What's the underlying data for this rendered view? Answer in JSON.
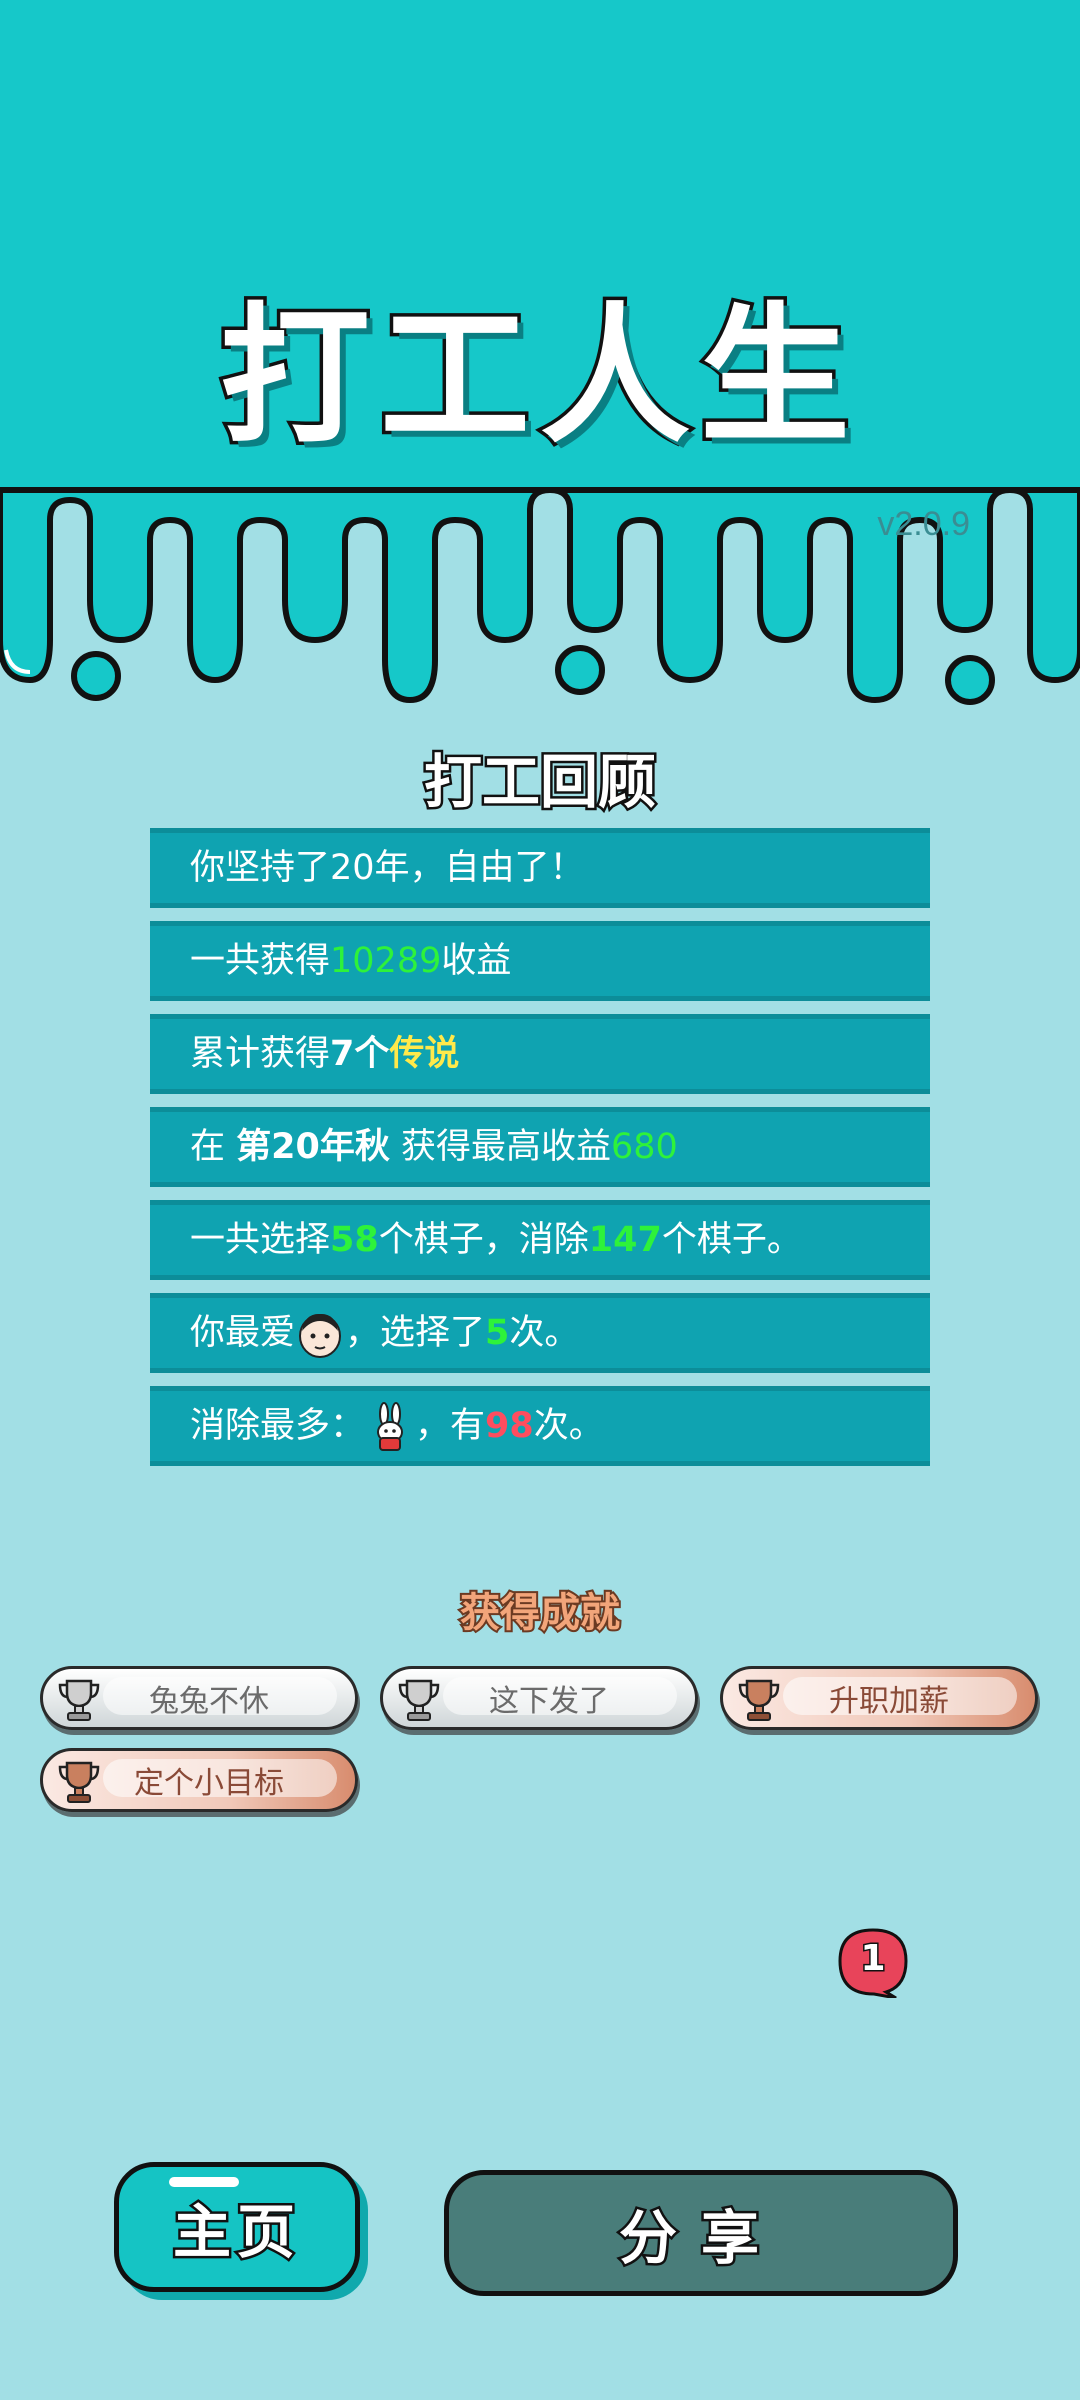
{
  "header": {
    "title": "打工人生",
    "version": "v2.0.9",
    "top_color": "#16c8c9",
    "bg_color": "#a2dfe5"
  },
  "review": {
    "title": "打工回顾",
    "rows": [
      {
        "prefix": "你坚持了20年，自由了！"
      },
      {
        "prefix": "一共获得",
        "value": "10289",
        "suffix": "收益"
      },
      {
        "prefix": "累计获得",
        "bold": "7个",
        "legend": "传说"
      },
      {
        "prefix": "在 ",
        "bold": "第20年秋",
        "mid": " 获得最高收益",
        "value": "680"
      },
      {
        "prefix": "一共选择",
        "v1": "58",
        "mid": "个棋子，消除",
        "v2": "147",
        "suffix": "个棋子。"
      },
      {
        "prefix": "你最爱",
        "icon": "man-face-icon",
        "mid": "，选择了",
        "value": "5",
        "suffix": "次。"
      },
      {
        "prefix": "消除最多：",
        "icon": "rabbit-icon",
        "mid": "，有",
        "value": "98",
        "suffix": "次。"
      }
    ]
  },
  "achievements": {
    "title": "获得成就",
    "items": [
      {
        "label": "兔兔不休",
        "tier": "silver"
      },
      {
        "label": "这下发了",
        "tier": "silver"
      },
      {
        "label": "升职加薪",
        "tier": "bronze"
      },
      {
        "label": "定个小目标",
        "tier": "bronze"
      }
    ]
  },
  "notification": {
    "count": "1"
  },
  "buttons": {
    "home_label": "主页",
    "share_label": "分享"
  }
}
